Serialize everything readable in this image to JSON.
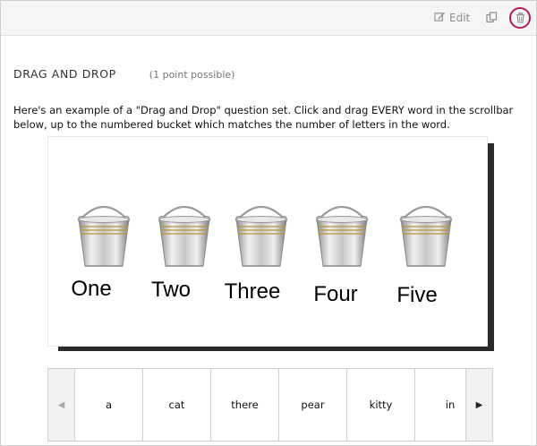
{
  "toolbar": {
    "edit_label": "Edit",
    "edit_icon": "pencil-square-icon",
    "copy_icon": "copy-icon",
    "delete_icon": "trash-icon",
    "delete_highlight_color": "#b01e5b"
  },
  "problem": {
    "title": "DRAG AND DROP",
    "points": "(1 point possible)",
    "description": "Here's an example of a \"Drag and Drop\" question set. Click and drag EVERY word in the scrollbar below, up to the numbered bucket which matches the number of letters in the word."
  },
  "buckets": [
    "One",
    "Two",
    "Three",
    "Four",
    "Five"
  ],
  "scroller": {
    "left_arrow": "◀",
    "right_arrow": "▶",
    "items": [
      "a",
      "cat",
      "there",
      "pear",
      "kitty",
      "in"
    ]
  }
}
